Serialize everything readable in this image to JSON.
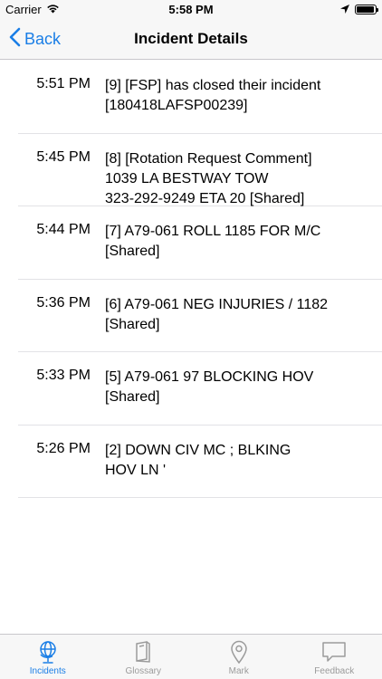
{
  "status_bar": {
    "carrier": "Carrier",
    "time": "5:58 PM",
    "battery_level": 0.95
  },
  "nav": {
    "back_label": "Back",
    "title": "Incident Details"
  },
  "incidents": [
    {
      "time": "5:51 PM",
      "text": "[9] [FSP] has closed their incident\n[180418LAFSP00239]"
    },
    {
      "time": "5:45 PM",
      "text": "[8] [Rotation Request Comment]\n1039 LA BESTWAY TOW\n323-292-9249 ETA 20 [Shared]"
    },
    {
      "time": "5:44 PM",
      "text": "[7] A79-061  ROLL 1185 FOR M/C\n[Shared]"
    },
    {
      "time": "5:36 PM",
      "text": "[6] A79-061  NEG INJURIES / 1182\n[Shared]"
    },
    {
      "time": "5:33 PM",
      "text": "[5] A79-061  97 BLOCKING HOV\n[Shared]"
    },
    {
      "time": "5:26 PM",
      "text": "[2] DOWN CIV MC ; BLKING\nHOV LN '"
    }
  ],
  "tabs": [
    {
      "label": "Incidents",
      "icon": "globe-icon",
      "active": true
    },
    {
      "label": "Glossary",
      "icon": "book-icon",
      "active": false
    },
    {
      "label": "Mark",
      "icon": "map-pin-icon",
      "active": false
    },
    {
      "label": "Feedback",
      "icon": "speech-bubble-icon",
      "active": false
    }
  ],
  "colors": {
    "accent": "#1a7ee6",
    "inactive": "#9b9b9b",
    "bar_background": "#f7f7f7"
  }
}
